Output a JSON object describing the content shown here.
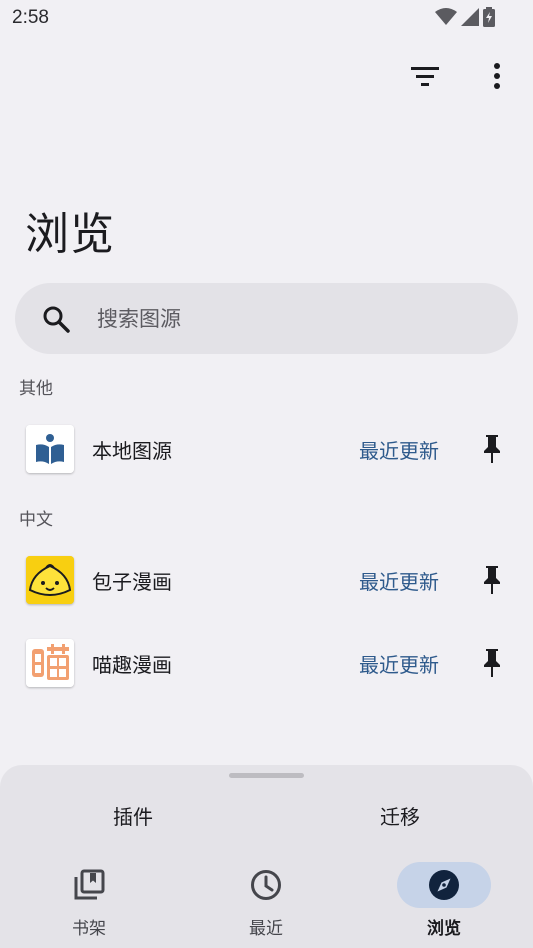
{
  "status_bar": {
    "time": "2:58"
  },
  "header": {
    "title": "浏览"
  },
  "search": {
    "placeholder": "搜索图源"
  },
  "sections": [
    {
      "title": "其他",
      "sources": [
        {
          "name": "本地图源",
          "latest": "最近更新",
          "icon": "local-source-icon"
        }
      ]
    },
    {
      "title": "中文",
      "sources": [
        {
          "name": "包子漫画",
          "latest": "最近更新",
          "icon": "baozi-manhua-icon"
        },
        {
          "name": "喵趣漫画",
          "latest": "最近更新",
          "icon": "miaoqu-manhua-icon"
        }
      ]
    }
  ],
  "sheet": {
    "tabs": [
      {
        "label": "插件"
      },
      {
        "label": "迁移"
      }
    ]
  },
  "nav": {
    "items": [
      {
        "label": "书架",
        "icon": "library-icon",
        "active": false
      },
      {
        "label": "最近",
        "icon": "history-icon",
        "active": false
      },
      {
        "label": "浏览",
        "icon": "compass-icon",
        "active": true
      }
    ]
  },
  "colors": {
    "background": "#f1f0f4",
    "accent_link": "#2e5a8c",
    "nav_active_pill": "#c6d3e8",
    "search_bg": "#e3e2e7"
  }
}
